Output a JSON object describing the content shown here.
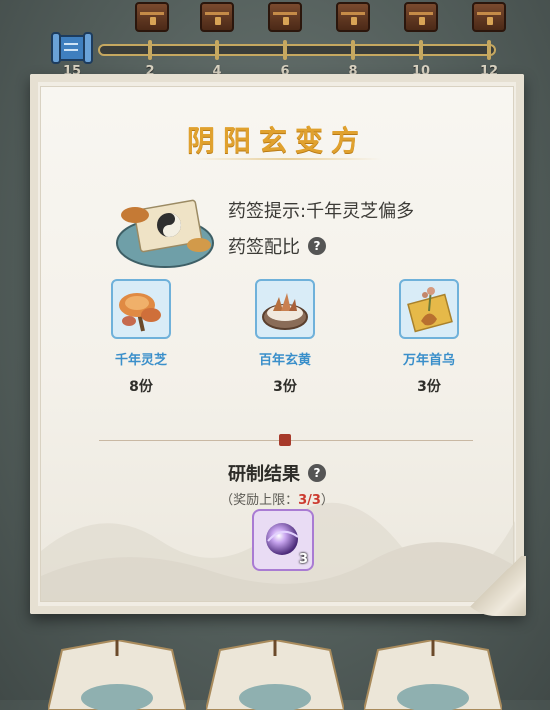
{
  "progress": {
    "milestones": [
      "15",
      "2",
      "4",
      "6",
      "8",
      "10",
      "12"
    ]
  },
  "recipe": {
    "title": "阴阳玄变方",
    "hint": "药签提示:千年灵芝偏多",
    "ratio_label": "药签配比",
    "help_symbol": "?"
  },
  "ingredients": [
    {
      "name": "千年灵芝",
      "qty": "8份",
      "icon": "lingzhi-icon"
    },
    {
      "name": "百年玄黄",
      "qty": "3份",
      "icon": "xuanhuang-icon"
    },
    {
      "name": "万年首乌",
      "qty": "3份",
      "icon": "shouwu-icon"
    }
  ],
  "result": {
    "title": "研制结果",
    "reward_limit_prefix": "（奖励上限：",
    "reward_limit_count": "3/3",
    "reward_limit_suffix": "）",
    "item_count": "3",
    "item_icon": "purple-orb-icon"
  },
  "colors": {
    "title": "#e0a12e",
    "ingredient_name": "#3a8fca",
    "limit_count": "#cc3b30",
    "ingredient_border": "#6fb1da",
    "result_border": "#a97bd3"
  }
}
